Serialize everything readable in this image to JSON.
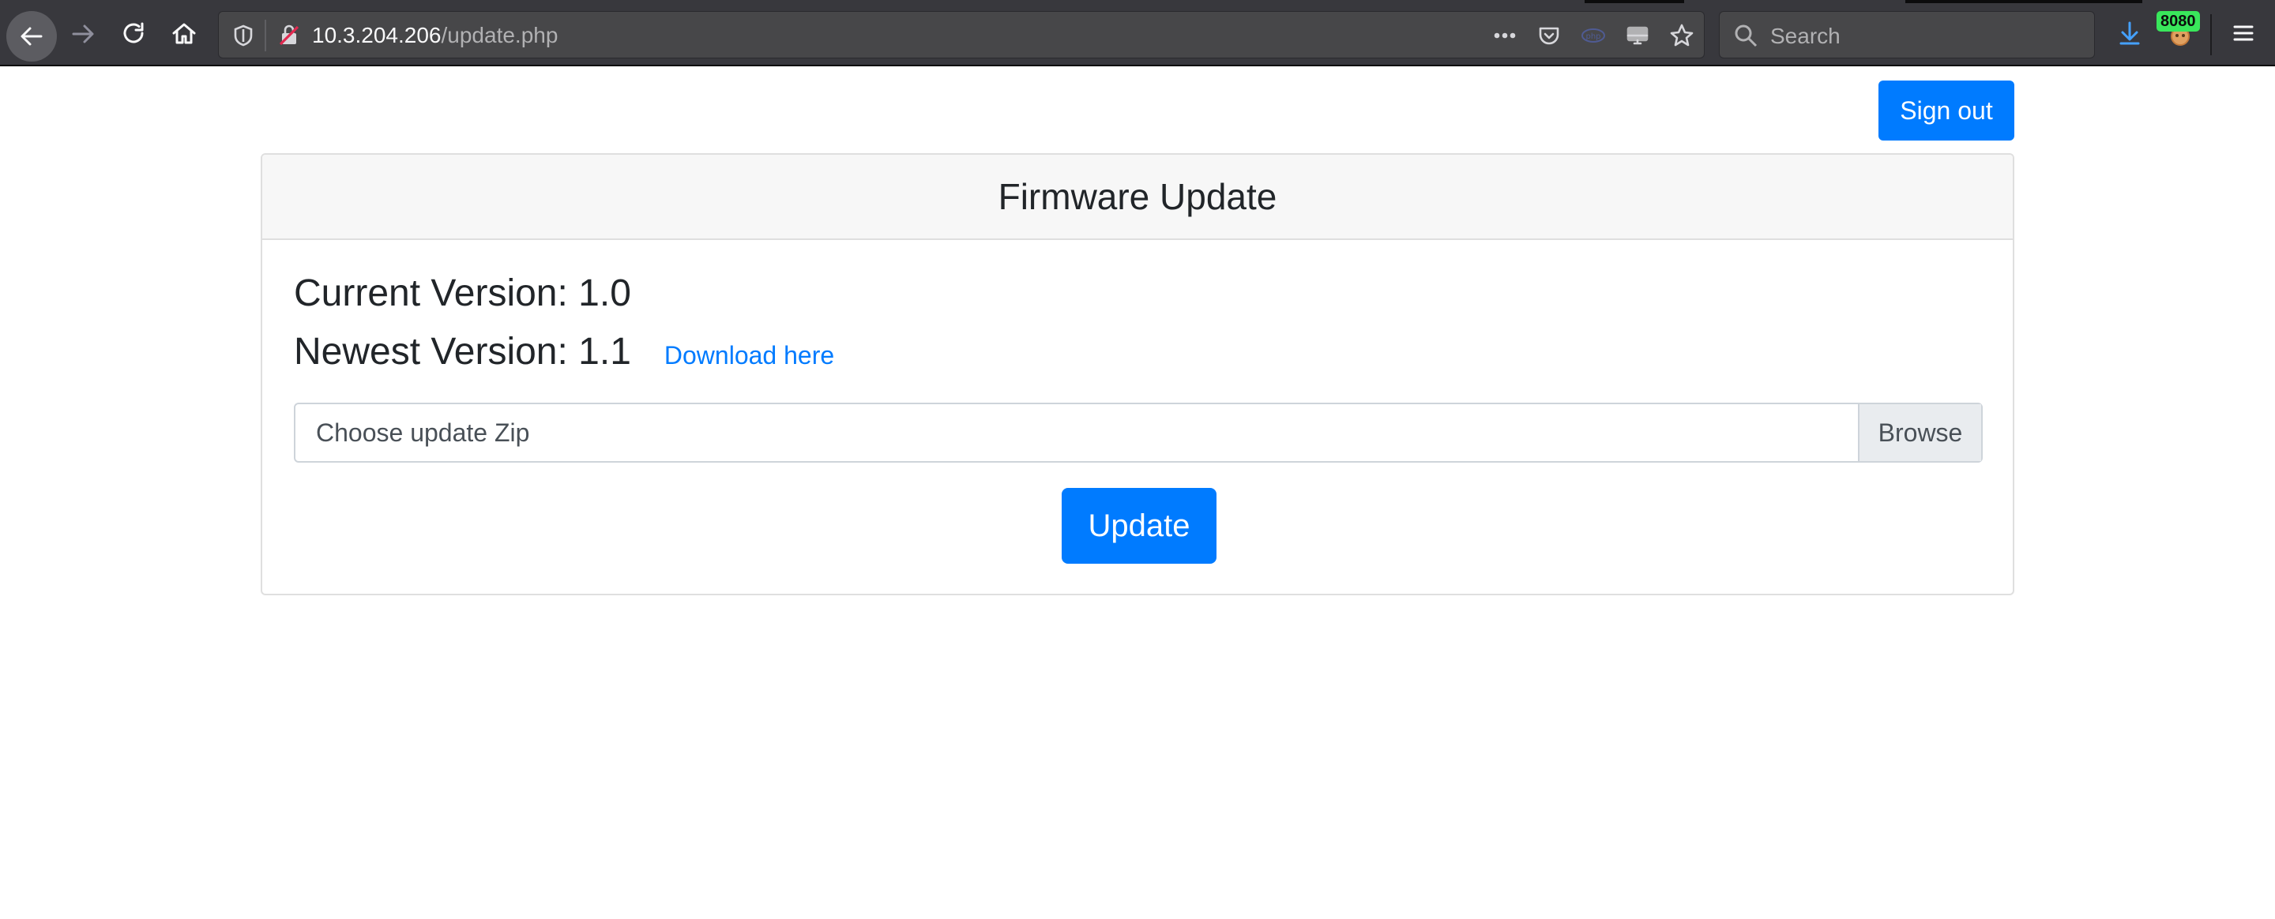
{
  "browser": {
    "url_host": "10.3.204.206",
    "url_path": "/update.php",
    "search_placeholder": "Search",
    "extension_badge": "8080",
    "colors": {
      "toolbar": "#38383d",
      "urlbar": "#474749",
      "download_icon": "#45a1ff"
    },
    "icons": [
      "back-arrow-icon",
      "forward-arrow-icon",
      "reload-icon",
      "home-icon",
      "tracking-protection-icon",
      "insecure-lock-icon",
      "page-actions-icon",
      "pocket-icon",
      "php-extension-icon",
      "screenshot-icon",
      "bookmark-star-icon",
      "search-icon",
      "download-icon",
      "extension-avatar-icon",
      "hamburger-menu-icon"
    ]
  },
  "page": {
    "signout_label": "Sign out",
    "card_title": "Firmware Update",
    "current_version": "Current Version: 1.0",
    "newest_version": "Newest Version: 1.1",
    "download_link": "Download here",
    "file_placeholder": "Choose update Zip",
    "browse_label": "Browse",
    "update_label": "Update",
    "colors": {
      "primary": "#007bff",
      "text": "#212529",
      "card_header": "#f7f7f7"
    }
  }
}
